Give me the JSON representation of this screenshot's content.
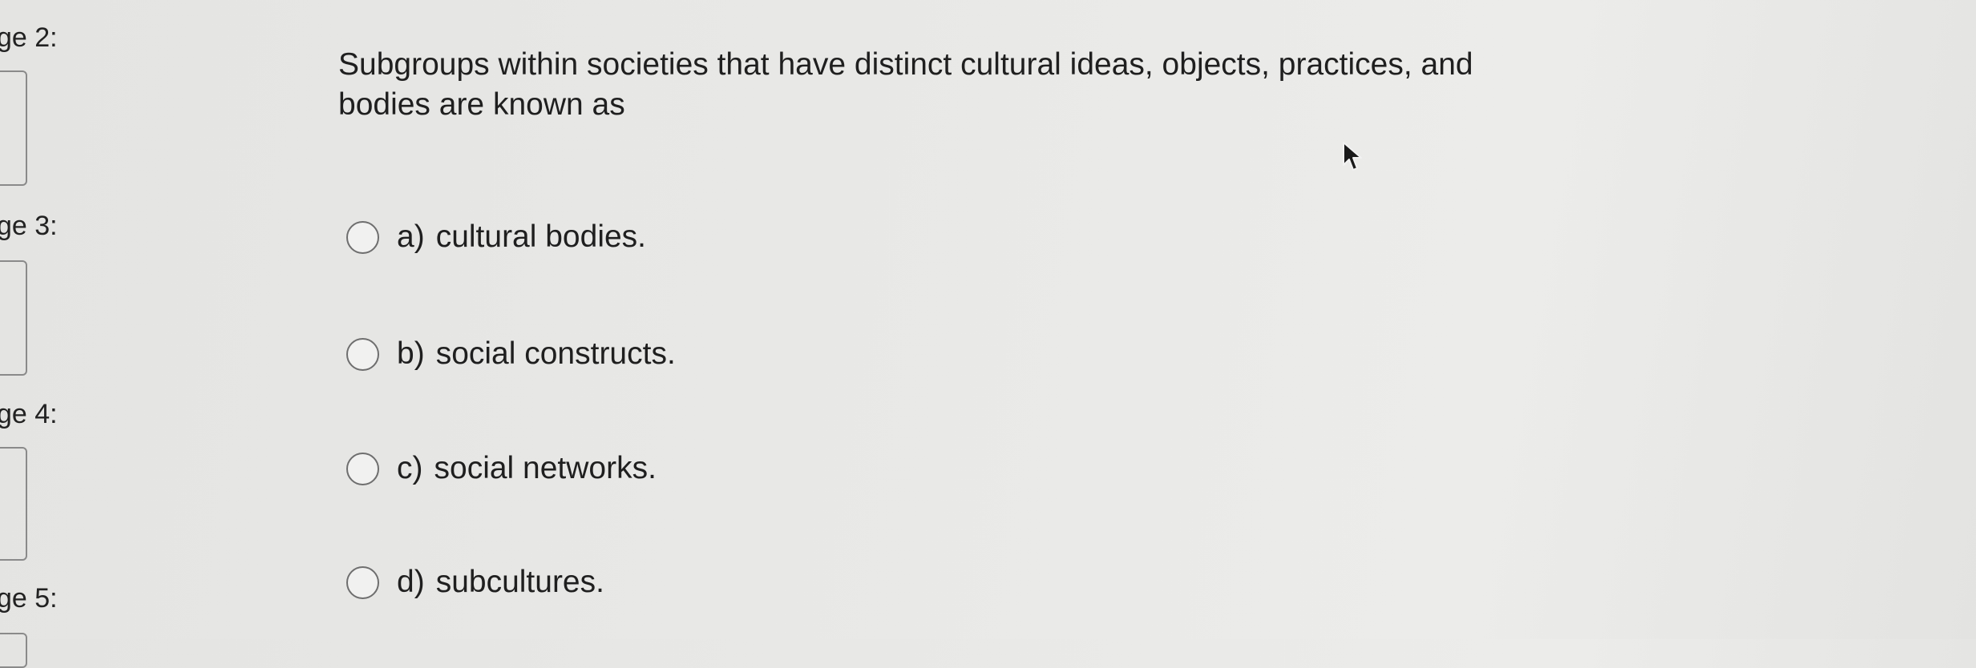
{
  "sidebar": {
    "pages": [
      {
        "label": "ge 2:"
      },
      {
        "label": "ge 3:"
      },
      {
        "label": "ge 4:"
      },
      {
        "label": "ge 5:"
      }
    ]
  },
  "question": {
    "text": "Subgroups within societies that have distinct cultural ideas, objects, practices, and bodies are known as",
    "options": [
      {
        "letter": "a)",
        "text": "cultural bodies."
      },
      {
        "letter": "b)",
        "text": "social constructs."
      },
      {
        "letter": "c)",
        "text": "social networks."
      },
      {
        "letter": "d)",
        "text": "subcultures."
      }
    ]
  },
  "cursor": {
    "icon": "mouse-pointer-icon"
  }
}
